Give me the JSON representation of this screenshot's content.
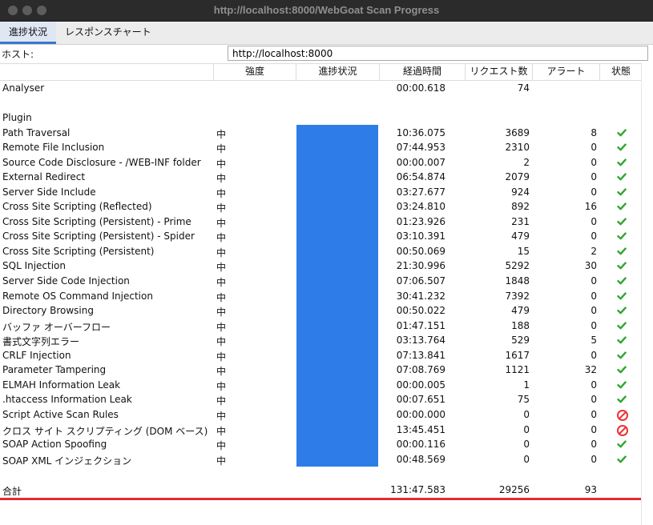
{
  "window": {
    "title": "http://localhost:8000/WebGoat Scan Progress"
  },
  "tabs": [
    {
      "label": "進捗状況",
      "selected": true
    },
    {
      "label": "レスポンスチャート",
      "selected": false
    }
  ],
  "host": {
    "label": "ホスト:",
    "value": "http://localhost:8000"
  },
  "columns": {
    "strength": "強度",
    "progress": "進捗状況",
    "elapsed": "経過時間",
    "requests": "リクエスト数",
    "alerts": "アラート",
    "state": "状態"
  },
  "analyser": {
    "name": "Analyser",
    "elapsed": "00:00.618",
    "requests": "74"
  },
  "plugin_header": "Plugin",
  "plugins": [
    {
      "name": "Path Traversal",
      "strength": "中",
      "elapsed": "10:36.075",
      "requests": "3689",
      "alerts": "8",
      "state": "check-icon"
    },
    {
      "name": "Remote File Inclusion",
      "strength": "中",
      "elapsed": "07:44.953",
      "requests": "2310",
      "alerts": "0",
      "state": "check-icon"
    },
    {
      "name": "Source Code Disclosure - /WEB-INF folder",
      "strength": "中",
      "elapsed": "00:00.007",
      "requests": "2",
      "alerts": "0",
      "state": "check-icon"
    },
    {
      "name": "External Redirect",
      "strength": "中",
      "elapsed": "06:54.874",
      "requests": "2079",
      "alerts": "0",
      "state": "check-icon"
    },
    {
      "name": "Server Side Include",
      "strength": "中",
      "elapsed": "03:27.677",
      "requests": "924",
      "alerts": "0",
      "state": "check-icon"
    },
    {
      "name": "Cross Site Scripting (Reflected)",
      "strength": "中",
      "elapsed": "03:24.810",
      "requests": "892",
      "alerts": "16",
      "state": "check-icon"
    },
    {
      "name": "Cross Site Scripting (Persistent) - Prime",
      "strength": "中",
      "elapsed": "01:23.926",
      "requests": "231",
      "alerts": "0",
      "state": "check-icon"
    },
    {
      "name": "Cross Site Scripting (Persistent) - Spider",
      "strength": "中",
      "elapsed": "03:10.391",
      "requests": "479",
      "alerts": "0",
      "state": "check-icon"
    },
    {
      "name": "Cross Site Scripting (Persistent)",
      "strength": "中",
      "elapsed": "00:50.069",
      "requests": "15",
      "alerts": "2",
      "state": "check-icon"
    },
    {
      "name": "SQL Injection",
      "strength": "中",
      "elapsed": "21:30.996",
      "requests": "5292",
      "alerts": "30",
      "state": "check-icon"
    },
    {
      "name": "Server Side Code Injection",
      "strength": "中",
      "elapsed": "07:06.507",
      "requests": "1848",
      "alerts": "0",
      "state": "check-icon"
    },
    {
      "name": "Remote OS Command Injection",
      "strength": "中",
      "elapsed": "30:41.232",
      "requests": "7392",
      "alerts": "0",
      "state": "check-icon"
    },
    {
      "name": "Directory Browsing",
      "strength": "中",
      "elapsed": "00:50.022",
      "requests": "479",
      "alerts": "0",
      "state": "check-icon"
    },
    {
      "name": "バッファ オーバーフロー",
      "strength": "中",
      "elapsed": "01:47.151",
      "requests": "188",
      "alerts": "0",
      "state": "check-icon"
    },
    {
      "name": "書式文字列エラー",
      "strength": "中",
      "elapsed": "03:13.764",
      "requests": "529",
      "alerts": "5",
      "state": "check-icon"
    },
    {
      "name": "CRLF Injection",
      "strength": "中",
      "elapsed": "07:13.841",
      "requests": "1617",
      "alerts": "0",
      "state": "check-icon"
    },
    {
      "name": "Parameter Tampering",
      "strength": "中",
      "elapsed": "07:08.769",
      "requests": "1121",
      "alerts": "32",
      "state": "check-icon"
    },
    {
      "name": "ELMAH Information Leak",
      "strength": "中",
      "elapsed": "00:00.005",
      "requests": "1",
      "alerts": "0",
      "state": "check-icon"
    },
    {
      "name": ".htaccess Information Leak",
      "strength": "中",
      "elapsed": "00:07.651",
      "requests": "75",
      "alerts": "0",
      "state": "check-icon"
    },
    {
      "name": "Script Active Scan Rules",
      "strength": "中",
      "elapsed": "00:00.000",
      "requests": "0",
      "alerts": "0",
      "state": "stop-icon"
    },
    {
      "name": "クロス サイト スクリプティング (DOM ベース)",
      "strength": "中",
      "elapsed": "13:45.451",
      "requests": "0",
      "alerts": "0",
      "state": "stop-icon"
    },
    {
      "name": "SOAP Action Spoofing",
      "strength": "中",
      "elapsed": "00:00.116",
      "requests": "0",
      "alerts": "0",
      "state": "check-icon"
    },
    {
      "name": "SOAP XML インジェクション",
      "strength": "中",
      "elapsed": "00:48.569",
      "requests": "0",
      "alerts": "0",
      "state": "check-icon"
    }
  ],
  "total": {
    "label": "合計",
    "elapsed": "131:47.583",
    "requests": "29256",
    "alerts": "93"
  },
  "colors": {
    "progress": "#2d7ce7",
    "check": "#2fa52f",
    "stop": "#e33333",
    "total_line": "#e32b2b"
  }
}
